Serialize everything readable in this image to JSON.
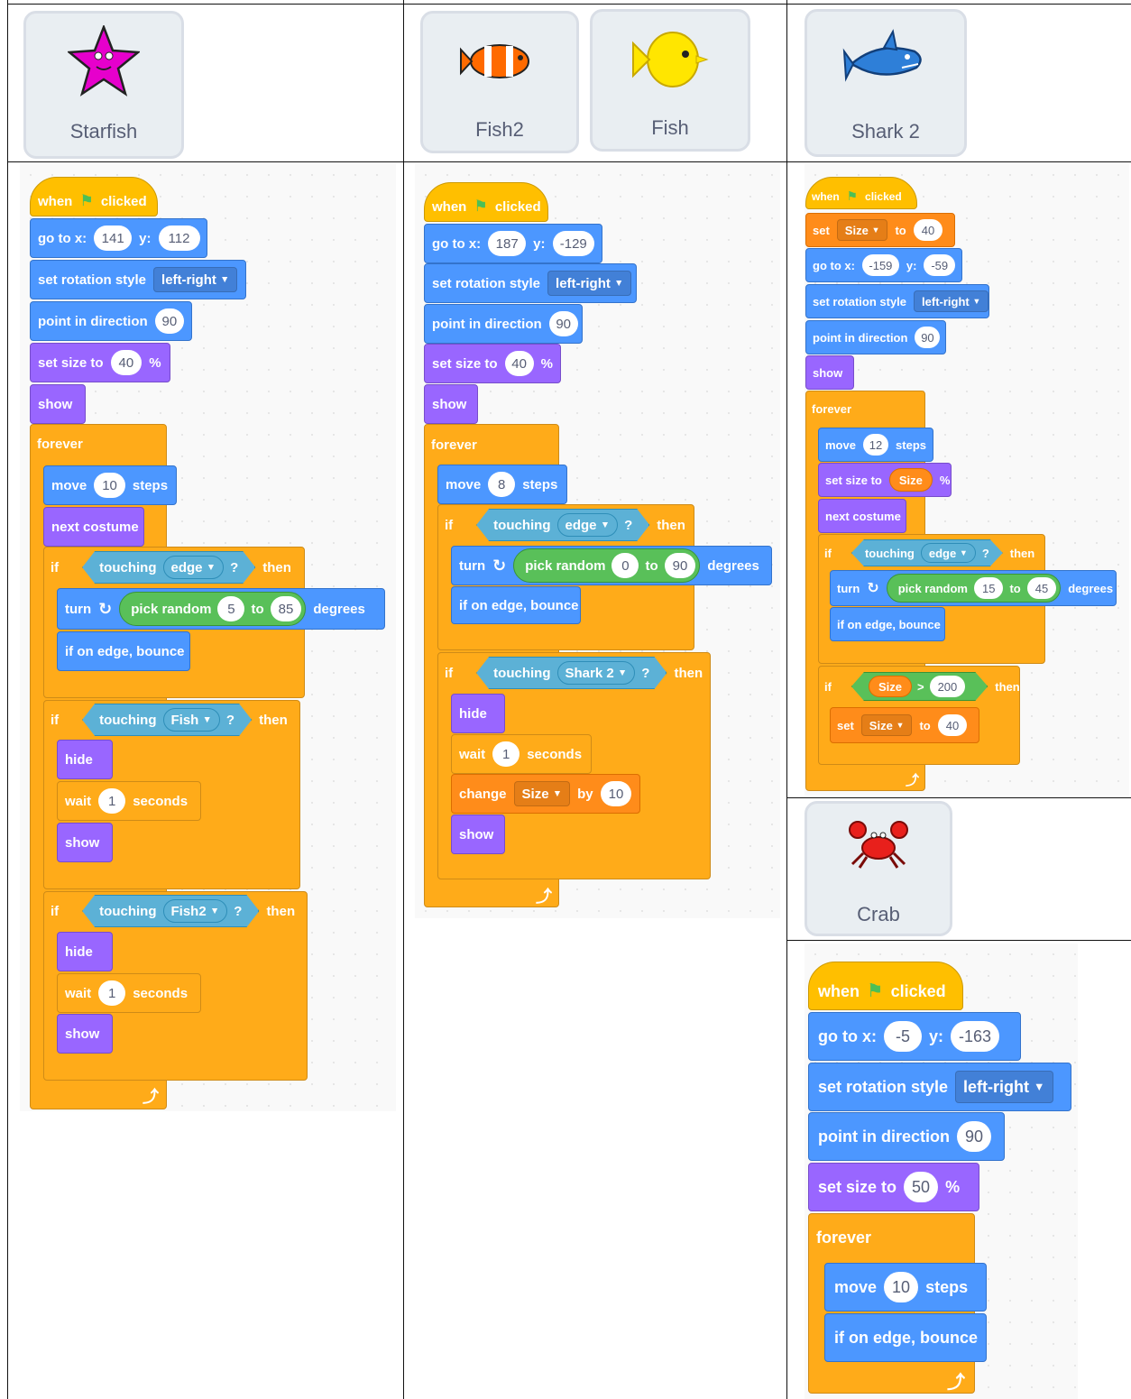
{
  "sprites": {
    "starfish": "Starfish",
    "fish2": "Fish2",
    "fish": "Fish",
    "shark": "Shark 2",
    "crab": "Crab"
  },
  "t": {
    "when": "when",
    "clicked": "clicked",
    "goto": "go to x:",
    "y": "y:",
    "rot": "set rotation style",
    "lr": "left-right",
    "dir": "point in direction",
    "setsize": "set size to",
    "pct": "%",
    "show": "show",
    "hide": "hide",
    "forever": "forever",
    "move": "move",
    "steps": "steps",
    "next": "next costume",
    "if": "if",
    "then": "then",
    "touching": "touching",
    "edge": "edge",
    "q": "?",
    "turn": "turn",
    "pick": "pick random",
    "to": "to",
    "degrees": "degrees",
    "bounce": "if on edge, bounce",
    "wait": "wait",
    "seconds": "seconds",
    "change": "change",
    "by": "by",
    "set": "set",
    "size": "Size",
    "gt": ">",
    "fish": "Fish",
    "fish2": "Fish2",
    "shark": "Shark 2"
  },
  "starfish_script": {
    "x": "141",
    "y": "112",
    "dir": "90",
    "size": "40",
    "move": "10",
    "rmin": "5",
    "rmax": "85",
    "w1": "1",
    "w2": "1"
  },
  "fish_script": {
    "x": "187",
    "y": "-129",
    "dir": "90",
    "size": "40",
    "move": "8",
    "rmin": "0",
    "rmax": "90",
    "wait": "1",
    "change": "10"
  },
  "shark_script": {
    "init": "40",
    "x": "-159",
    "y": "-59",
    "dir": "90",
    "move": "12",
    "rmin": "15",
    "rmax": "45",
    "limit": "200",
    "reset": "40"
  },
  "crab_script": {
    "x": "-5",
    "y": "-163",
    "dir": "90",
    "size": "50",
    "move": "10"
  },
  "colors": {
    "motion": "#4c97ff",
    "looks": "#9966ff",
    "control": "#ffab19",
    "events": "#ffbf00",
    "sensing": "#5cb1d6",
    "operators": "#59c059",
    "variables": "#ff8c1a"
  }
}
